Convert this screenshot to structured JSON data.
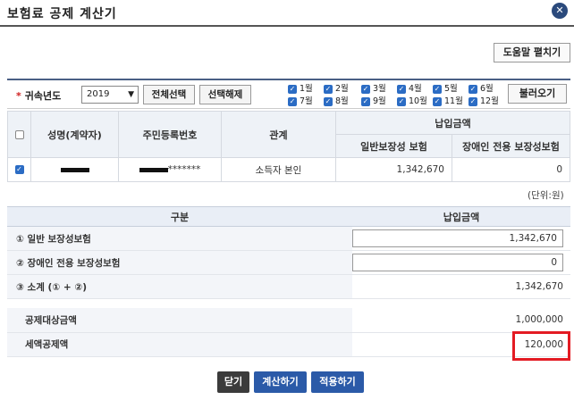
{
  "window": {
    "title": "보험료 공제 계산기",
    "close_icon": "close-icon"
  },
  "toolbar": {
    "help_label": "도움말 펼치기"
  },
  "filter": {
    "year_label": "귀속년도",
    "year_value": "2019",
    "select_all_label": "전체선택",
    "deselect_label": "선택해제",
    "load_label": "불러오기",
    "months": [
      "1월",
      "2월",
      "3월",
      "4월",
      "5월",
      "6월",
      "7월",
      "8월",
      "9월",
      "10월",
      "11월",
      "12월"
    ]
  },
  "payee_table": {
    "headers": {
      "name": "성명(계약자)",
      "rrn": "주민등록번호",
      "relation": "관계",
      "payment": "납입금액",
      "general": "일반보장성 보험",
      "disabled": "장애인 전용 보장성보험"
    },
    "rows": [
      {
        "rrn_suffix": "*******",
        "relation": "소득자 본인",
        "general": "1,342,670",
        "disabled": "0"
      }
    ]
  },
  "unit_label": "(단위:원)",
  "summary": {
    "header_category": "구분",
    "header_amount": "납입금액",
    "rows": [
      {
        "label": "① 일반 보장성보험",
        "value": "1,342,670"
      },
      {
        "label": "② 장애인 전용 보장성보험",
        "value": "0"
      },
      {
        "label": "③ 소계 (① + ②)",
        "value": "1,342,670"
      }
    ]
  },
  "deduction": {
    "target_label": "공제대상금액",
    "target_value": "1,000,000",
    "tax_label": "세액공제액",
    "tax_value": "120,000"
  },
  "buttons": {
    "close": "닫기",
    "calculate": "계산하기",
    "apply": "적용하기"
  },
  "colors": {
    "close_btn": "#3b3b3b",
    "calc_btn": "#2b5aa8",
    "apply_btn": "#2b5aa8",
    "highlight": "#e31b23",
    "checkbox": "#2b6cc4"
  }
}
